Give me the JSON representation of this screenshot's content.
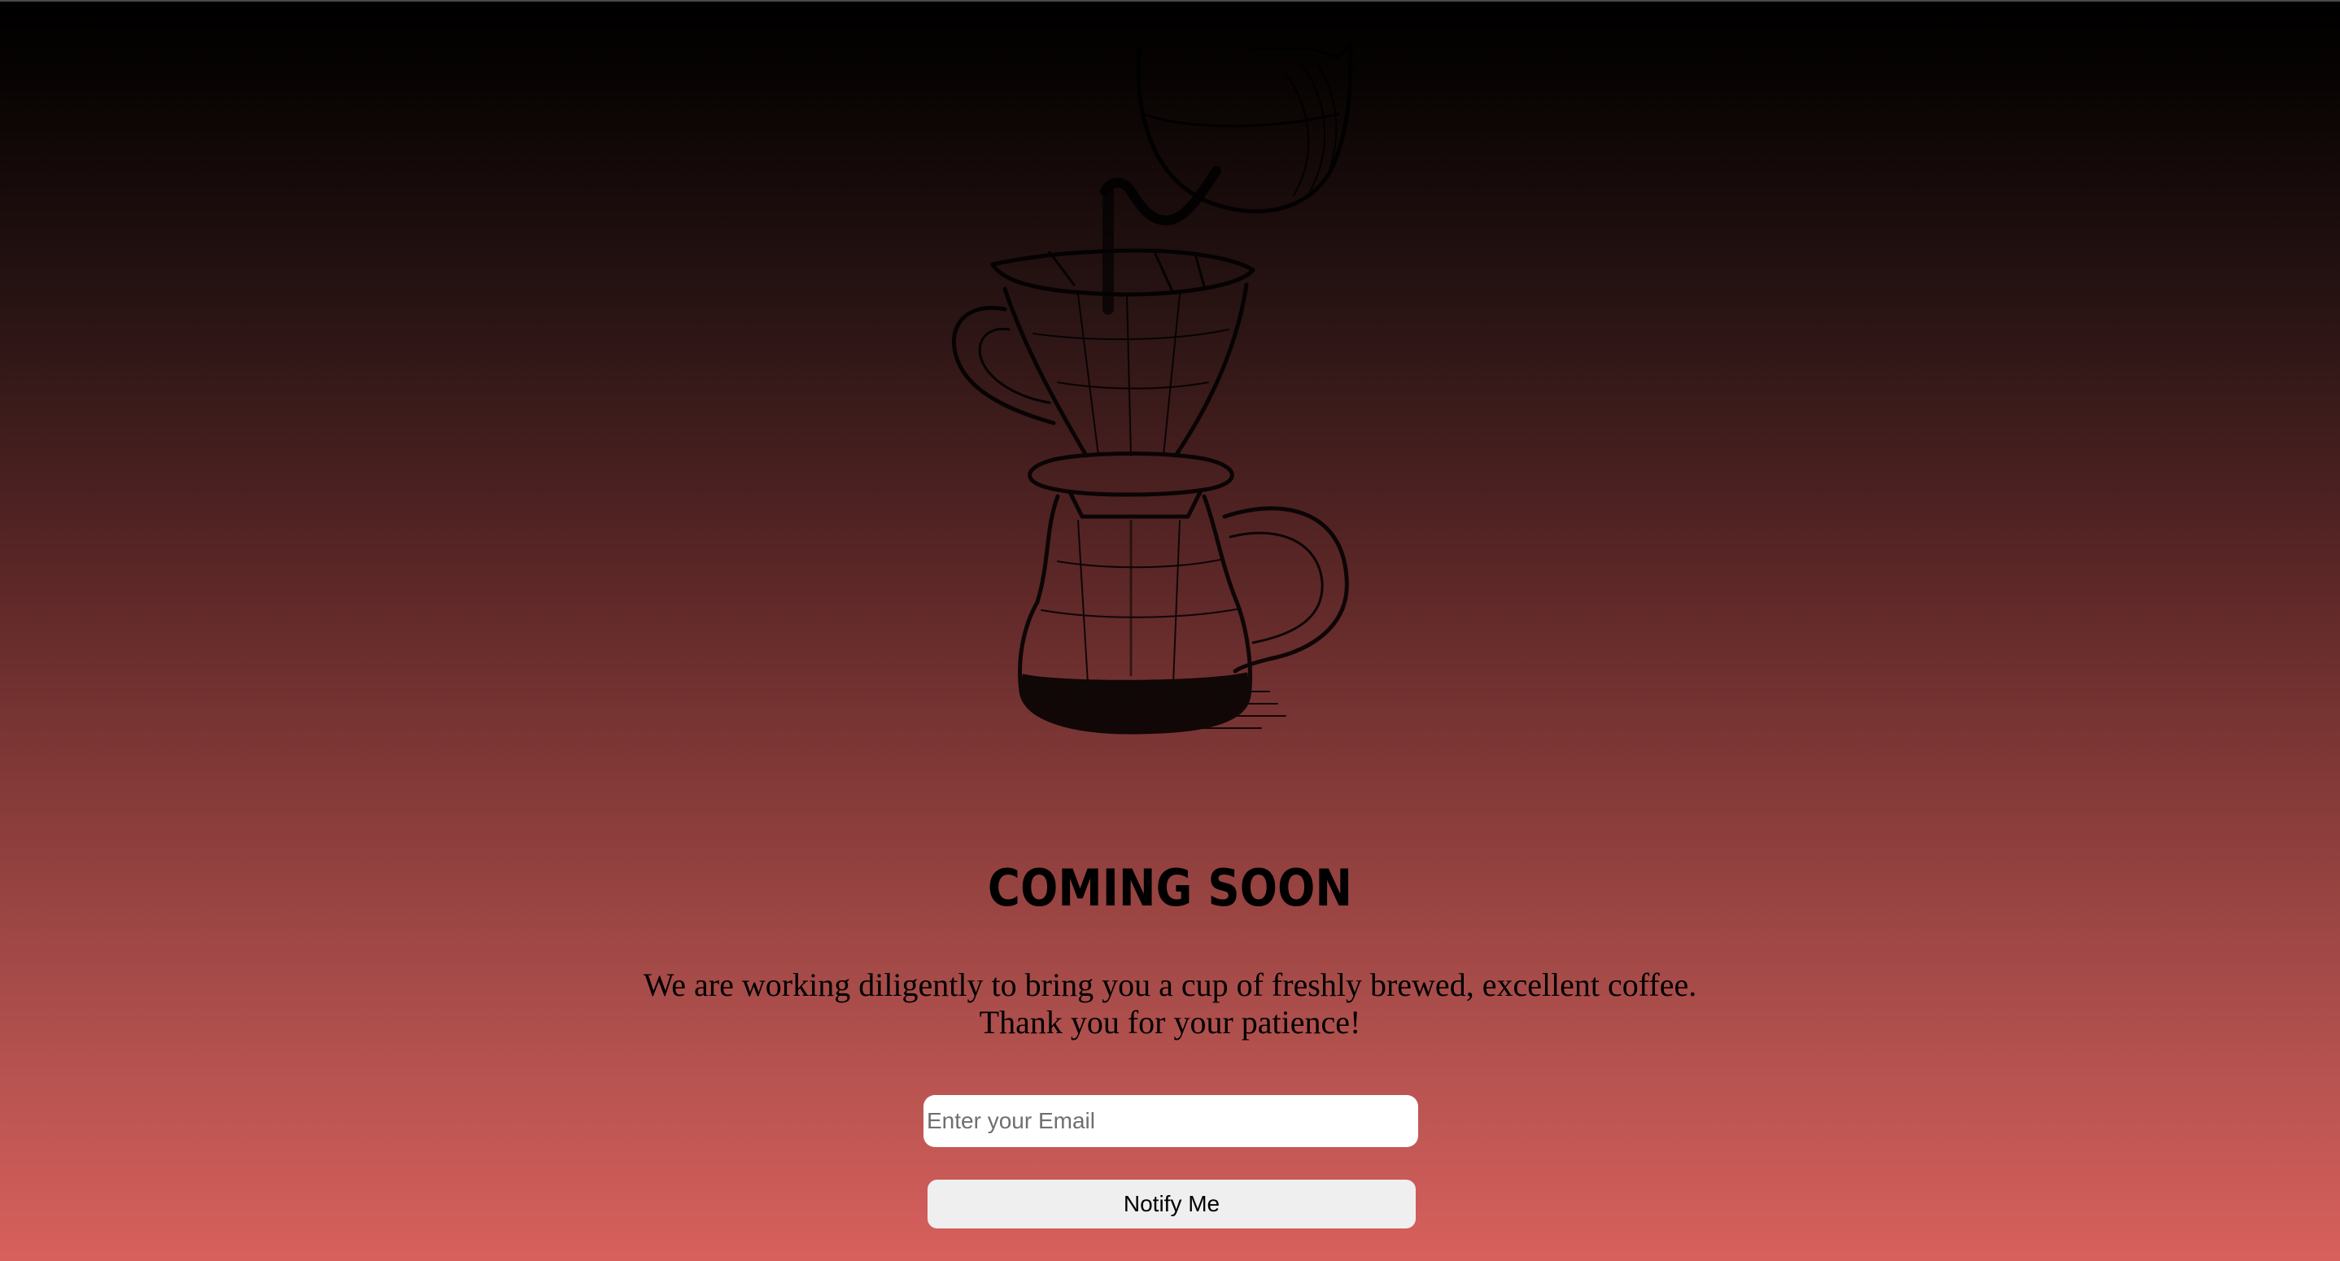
{
  "page": {
    "title": "COMING SOON",
    "message_line1": "We are working diligently to bring you a cup of freshly brewed, excellent coffee.",
    "message_line2": "Thank you for your patience!"
  },
  "form": {
    "email_placeholder": "Enter your Email",
    "email_value": "",
    "notify_label": "Notify Me"
  },
  "hero": {
    "illustration": "pour-over-coffee-dripper-and-kettle-icon"
  },
  "colors": {
    "gradient_top": "#000000",
    "gradient_bottom": "#d8605c",
    "text": "#000000",
    "button_bg": "#efefef",
    "input_bg": "#ffffff"
  }
}
